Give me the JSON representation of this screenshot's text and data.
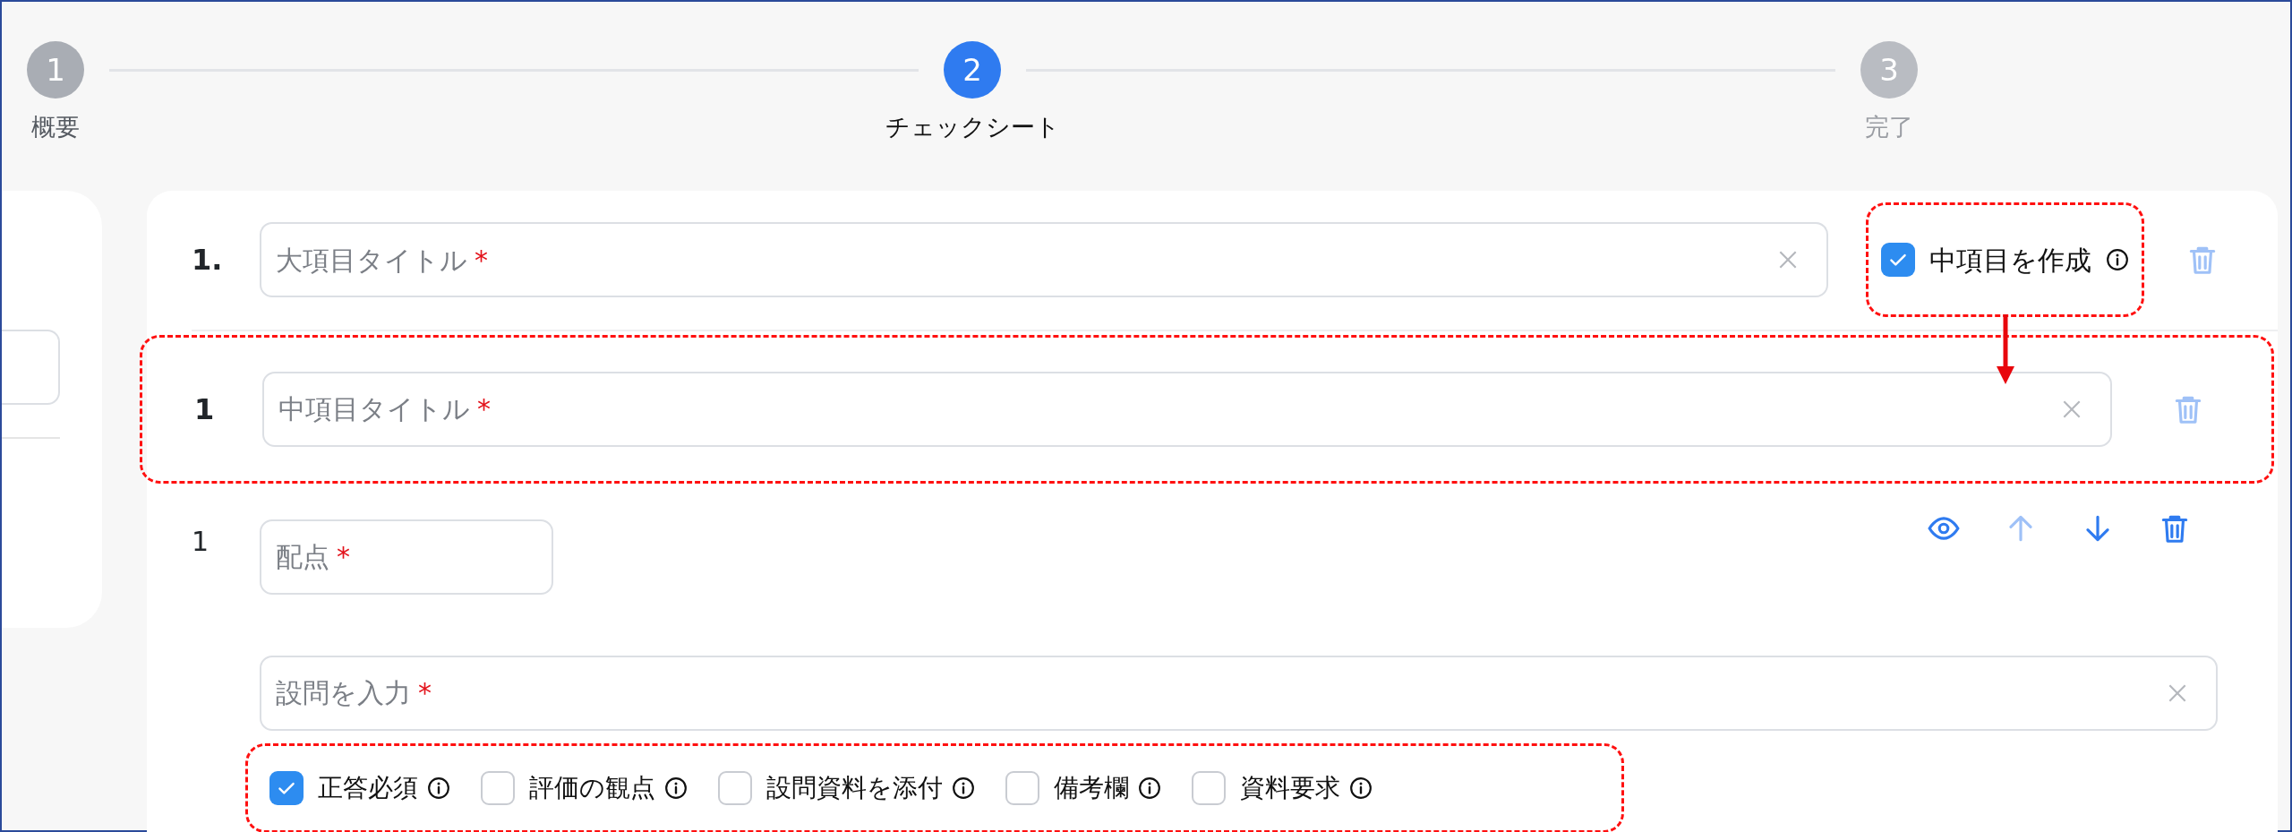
{
  "stepper": {
    "steps": [
      {
        "number": "1",
        "label": "概要",
        "done": true,
        "selected": false
      },
      {
        "number": "2",
        "label": "チェックシート",
        "done": false,
        "selected": true
      },
      {
        "number": "3",
        "label": "完了",
        "done": false,
        "selected": false
      }
    ]
  },
  "major_item": {
    "number": "1.",
    "title_field": {
      "placeholder": "大項目タイトル",
      "required_mark": "*"
    },
    "create_sub_items": {
      "label": "中項目を作成",
      "checked": true
    },
    "delete_disabled": true
  },
  "sub_item": {
    "number": "1",
    "title_field": {
      "placeholder": "中項目タイトル",
      "required_mark": "*"
    },
    "delete_disabled": true
  },
  "question": {
    "number": "1",
    "score_field": {
      "placeholder": "配点",
      "required_mark": "*"
    },
    "actions": [
      {
        "kind": "preview",
        "disabled": false
      },
      {
        "kind": "move_up",
        "disabled": true
      },
      {
        "kind": "move_down",
        "disabled": false
      },
      {
        "kind": "delete",
        "disabled": false
      }
    ],
    "question_field": {
      "placeholder": "設問を入力",
      "required_mark": "*"
    },
    "options": [
      {
        "label": "正答必須",
        "checked": true
      },
      {
        "label": "評価の観点",
        "checked": false
      },
      {
        "label": "設問資料を添付",
        "checked": false
      },
      {
        "label": "備考欄",
        "checked": false
      },
      {
        "label": "資料要求",
        "checked": false
      }
    ]
  }
}
